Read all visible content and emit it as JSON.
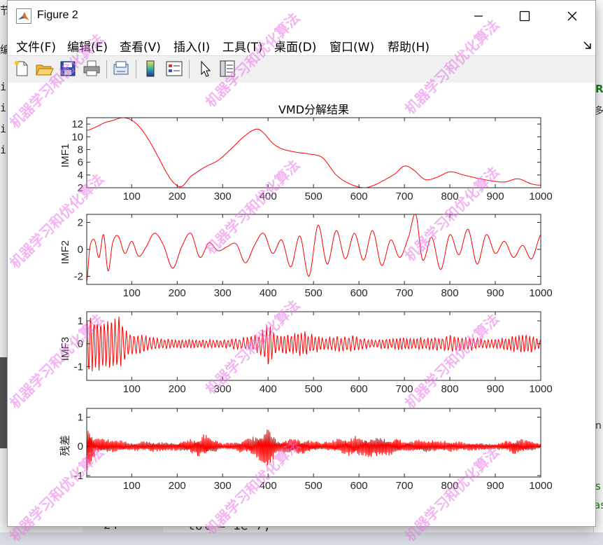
{
  "window": {
    "title": "Figure 2"
  },
  "menu": [
    "文件(F)",
    "编辑(E)",
    "查看(V)",
    "插入(I)",
    "工具(T)",
    "桌面(D)",
    "窗口(W)",
    "帮助(H)"
  ],
  "toolbar": {
    "buttons": [
      "new-figure-icon",
      "open-file-icon",
      "save-icon",
      "print-icon",
      "link-plot-icon",
      "insert-colorbar-icon",
      "insert-legend-icon",
      "edit-plot-icon",
      "property-inspector-icon"
    ]
  },
  "background": {
    "left_fragments": [
      "节",
      "编",
      "in",
      "in",
      "in",
      "in"
    ],
    "right_fragments": [
      "R",
      "多",
      "n",
      "s",
      "as"
    ],
    "code_line_number": "24",
    "code_text": "tol = 1e-7;"
  },
  "watermark_text": "机器学习和优化算法",
  "colors": {
    "line": "#ff0000",
    "axis": "#262626"
  },
  "chart_data": [
    {
      "type": "line",
      "title": "VMD分解结果",
      "ylabel": "IMF1",
      "xlim": [
        1,
        1000
      ],
      "ylim": [
        2,
        13
      ],
      "xticks": [
        100,
        200,
        300,
        400,
        500,
        600,
        700,
        800,
        900,
        1000
      ],
      "yticks": [
        2,
        4,
        6,
        8,
        10,
        12
      ],
      "x": [
        1,
        20,
        40,
        60,
        80,
        100,
        120,
        140,
        160,
        180,
        195,
        210,
        230,
        260,
        290,
        320,
        350,
        375,
        390,
        410,
        430,
        460,
        490,
        520,
        550,
        580,
        610,
        630,
        650,
        680,
        700,
        720,
        745,
        770,
        800,
        830,
        860,
        890,
        920,
        950,
        980,
        1000
      ],
      "values": [
        11,
        11.5,
        12.2,
        12.6,
        13,
        12.6,
        11.3,
        9.2,
        6.6,
        4.0,
        2.6,
        2.2,
        3.8,
        5.2,
        6.3,
        8.2,
        10.2,
        11.2,
        10.6,
        9.0,
        8.1,
        7.6,
        7.3,
        6.7,
        4.0,
        2.6,
        2.0,
        2.3,
        3.0,
        4.2,
        5.4,
        4.8,
        3.3,
        3.6,
        4.5,
        4.0,
        3.5,
        3.1,
        2.9,
        3.4,
        2.6,
        2.4
      ]
    },
    {
      "type": "line",
      "ylabel": "IMF2",
      "xlim": [
        1,
        1000
      ],
      "ylim": [
        -2.6,
        2.6
      ],
      "xticks": [
        100,
        200,
        300,
        400,
        500,
        600,
        700,
        800,
        900,
        1000
      ],
      "yticks": [
        -2,
        0,
        2
      ],
      "x": [
        1,
        8,
        18,
        28,
        38,
        48,
        58,
        70,
        85,
        100,
        115,
        130,
        150,
        170,
        190,
        210,
        230,
        250,
        270,
        290,
        310,
        330,
        350,
        370,
        390,
        410,
        430,
        450,
        470,
        490,
        510,
        530,
        550,
        570,
        590,
        610,
        630,
        650,
        670,
        690,
        710,
        725,
        740,
        760,
        780,
        800,
        820,
        840,
        860,
        880,
        900,
        920,
        940,
        960,
        980,
        1000
      ],
      "values": [
        -2.4,
        0.2,
        0.7,
        -0.6,
        1.1,
        -1.6,
        0.5,
        1.0,
        -0.3,
        0.6,
        -0.5,
        0.1,
        1.2,
        0.3,
        -1.4,
        0.2,
        1.2,
        -0.6,
        0.5,
        -0.1,
        0.2,
        0.4,
        -1.0,
        0.3,
        1.2,
        -0.3,
        0.7,
        -1.3,
        1.0,
        -2.0,
        1.8,
        -1.1,
        1.4,
        -0.7,
        1.2,
        -0.8,
        1.4,
        -1.2,
        0.7,
        -0.6,
        1.0,
        2.6,
        -0.8,
        0.9,
        -1.5,
        1.1,
        -0.4,
        1.5,
        -1.1,
        1.1,
        -0.3,
        0.6,
        -0.6,
        0.3,
        -0.7,
        1.1
      ]
    },
    {
      "type": "line",
      "ylabel": "IMF3",
      "xlim": [
        1,
        1000
      ],
      "ylim": [
        -1.6,
        1.4
      ],
      "xticks": [
        100,
        200,
        300,
        400,
        500,
        600,
        700,
        800,
        900,
        1000
      ],
      "yticks": [
        -1,
        0,
        1
      ],
      "x": [
        1,
        40,
        60,
        75,
        90,
        110,
        150,
        200,
        250,
        300,
        350,
        380,
        400,
        420,
        480,
        520,
        580,
        620,
        700,
        750,
        800,
        850,
        900,
        970,
        1000
      ],
      "amplitude": [
        1.4,
        1.2,
        1.4,
        1.3,
        0.6,
        0.5,
        0.3,
        0.2,
        0.2,
        0.2,
        0.3,
        0.5,
        1.0,
        0.4,
        0.6,
        0.3,
        0.4,
        0.2,
        0.3,
        0.3,
        0.4,
        0.3,
        0.2,
        0.5,
        0.2
      ],
      "period_samples": 8
    },
    {
      "type": "line",
      "ylabel": "残差",
      "xlim": [
        1,
        1000
      ],
      "ylim": [
        -1.05,
        1.3
      ],
      "xticks": [
        100,
        200,
        300,
        400,
        500,
        600,
        700,
        800,
        900,
        1000
      ],
      "yticks": [
        -1,
        0,
        1
      ],
      "x": [
        1,
        20,
        60,
        100,
        150,
        200,
        225,
        260,
        300,
        350,
        380,
        400,
        420,
        470,
        520,
        570,
        650,
        700,
        750,
        800,
        850,
        900,
        950,
        1000
      ],
      "amplitude": [
        1.0,
        0.3,
        0.25,
        0.15,
        0.2,
        0.15,
        0.25,
        0.45,
        0.1,
        0.25,
        0.5,
        0.8,
        0.25,
        0.3,
        0.15,
        0.35,
        0.4,
        0.2,
        0.25,
        0.2,
        0.15,
        0.1,
        0.3,
        0.1
      ],
      "period_samples": 3
    }
  ]
}
